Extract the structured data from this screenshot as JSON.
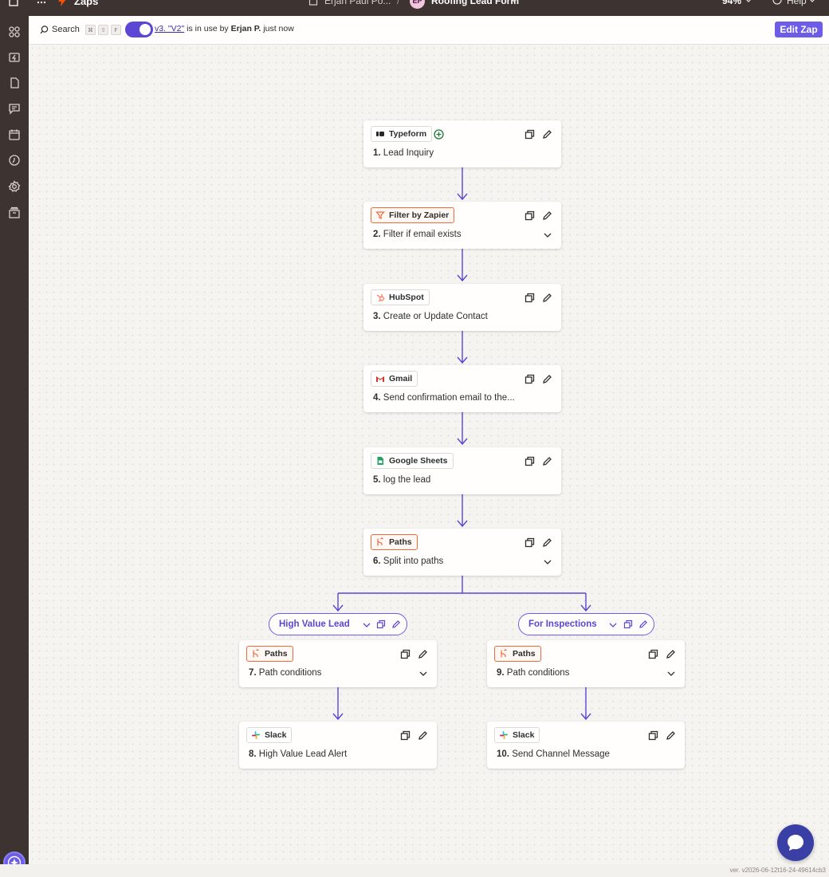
{
  "topbar": {
    "app_label": "Zaps",
    "folder_label": "Erjan Paul Po...",
    "separator": "/",
    "owner_initials": "EP",
    "zap_name": "Roofing Lead Form",
    "zoom": "94%",
    "help_label": "Help",
    "icons": [
      "home-icon",
      "apps-grid-icon",
      "zapier-bolt-icon",
      "document-icon",
      "chevron-down-icon",
      "help-icon"
    ]
  },
  "sidebar": {
    "icons": [
      "apps-icon",
      "zap-history-icon",
      "document-icon",
      "chat-icon",
      "calendar-icon",
      "history-icon",
      "settings-icon",
      "archive-icon",
      "ai-assistant-icon"
    ]
  },
  "toolbar": {
    "search_label": "Search",
    "shortcut_keys": [
      "⌘",
      "⇧",
      "F"
    ],
    "toggle_on": true,
    "version_link": "v3. \"V2\"",
    "version_text": " is in use by ",
    "version_user": "Erjan P.",
    "version_time": " just now",
    "edit_button": "Edit Zap"
  },
  "steps": [
    {
      "app": "Typeform",
      "icon": "typeform-icon",
      "num": "1.",
      "title": "Lead Inquiry"
    },
    {
      "app": "Filter by Zapier",
      "icon": "filter-icon",
      "num": "2.",
      "title": "Filter if email exists"
    },
    {
      "app": "HubSpot",
      "icon": "hubspot-icon",
      "num": "3.",
      "title": "Create or Update Contact"
    },
    {
      "app": "Gmail",
      "icon": "gmail-icon",
      "num": "4.",
      "title": "Send confirmation email to the..."
    },
    {
      "app": "Google Sheets",
      "icon": "google-sheets-icon",
      "num": "5.",
      "title": "log the lead"
    },
    {
      "app": "Paths",
      "icon": "paths-icon",
      "num": "6.",
      "title": "Split into paths"
    },
    {
      "app": "Paths",
      "icon": "paths-icon",
      "num": "7.",
      "title": "Path conditions"
    },
    {
      "app": "Slack",
      "icon": "slack-icon",
      "num": "8.",
      "title": "High Value Lead Alert"
    },
    {
      "app": "Paths",
      "icon": "paths-icon",
      "num": "9.",
      "title": "Path conditions"
    },
    {
      "app": "Slack",
      "icon": "slack-icon",
      "num": "10.",
      "title": "Send Channel Message"
    }
  ],
  "paths": [
    {
      "label": "High Value Lead"
    },
    {
      "label": "For Inspections"
    }
  ],
  "colors": {
    "accent": "#6c5ce7",
    "connector": "#5a47d6",
    "sidebar": "#3d3432",
    "paths_orange": "#ef6a3a",
    "chat_button": "#3a3fa6"
  },
  "footer": {
    "version": "ver. v2026-06-12t16-24-49614cb3"
  }
}
